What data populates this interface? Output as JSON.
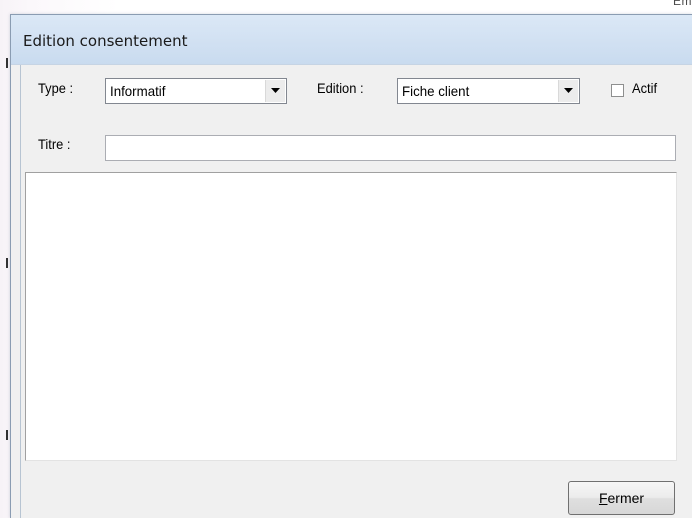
{
  "background": {
    "corner_text": "Em"
  },
  "window": {
    "title": "Edition consentement"
  },
  "form": {
    "type_label": "Type :",
    "type_value": "Informatif",
    "edition_label": "Edition :",
    "edition_value": "Fiche client",
    "actif_label": "Actif",
    "actif_checked": false,
    "titre_label": "Titre :",
    "titre_value": "",
    "content_value": ""
  },
  "footer": {
    "close_button_mnemonic": "F",
    "close_button_rest": "ermer"
  },
  "icons": {
    "dropdown": "chevron-down-icon"
  },
  "colors": {
    "titlebar": "#d3e2f3",
    "client_bg": "#f0f0f0",
    "field_border": "#828790"
  }
}
